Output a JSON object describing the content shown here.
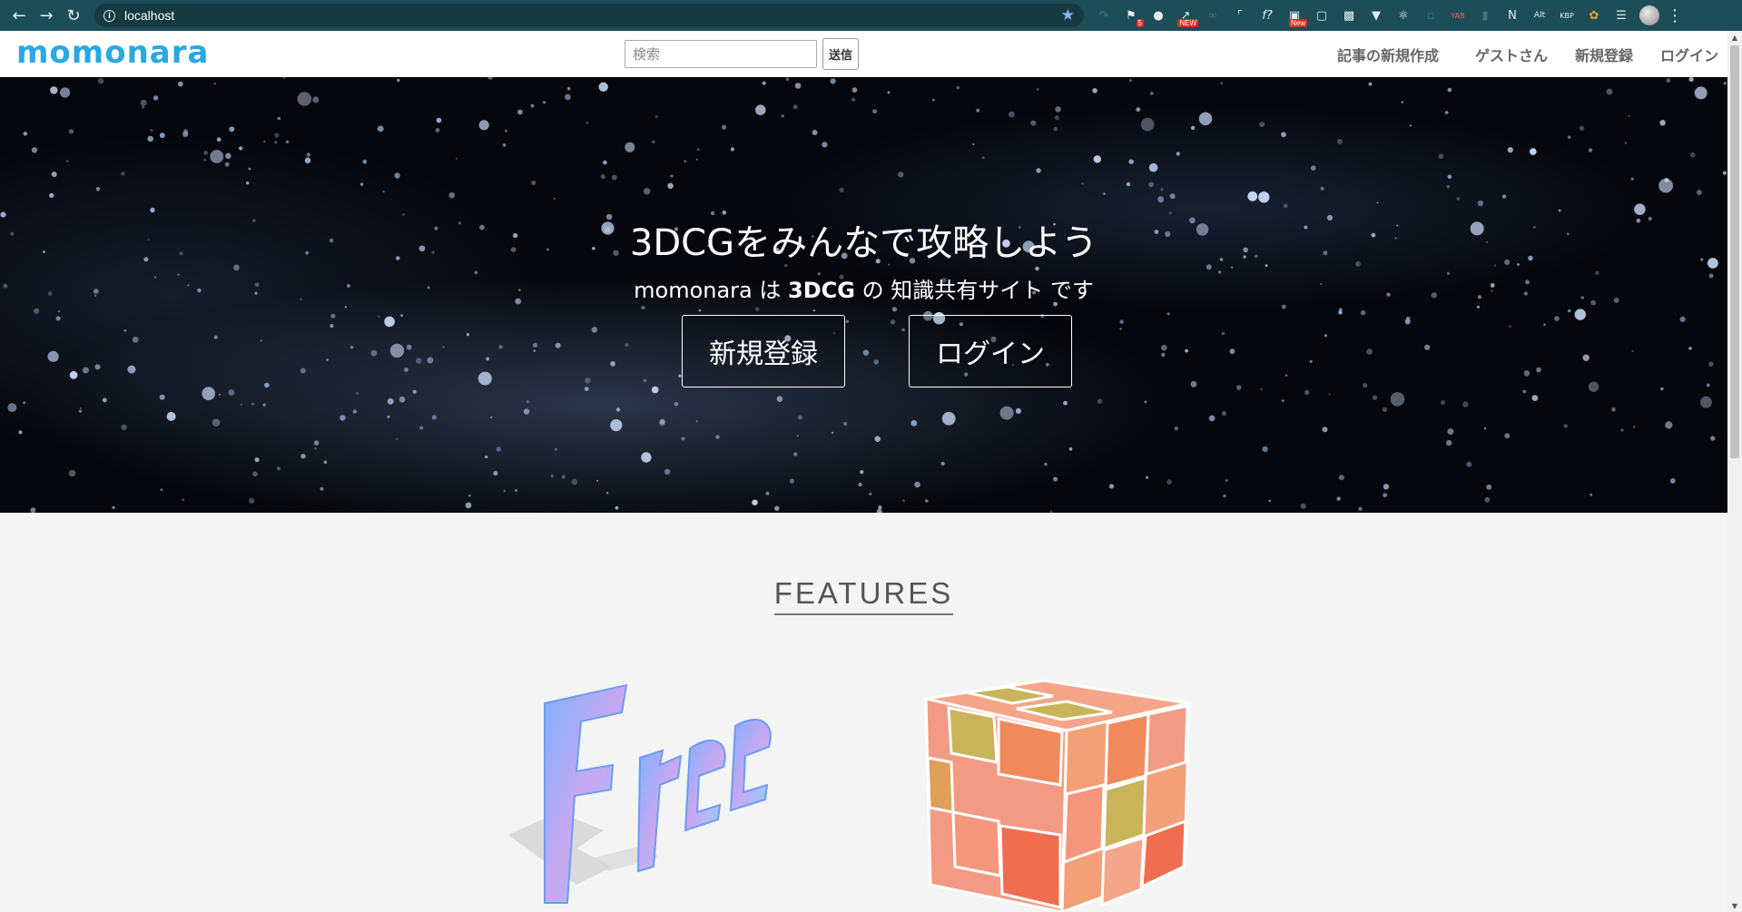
{
  "browser": {
    "url": "localhost",
    "extensions": [
      "flag-icon",
      "devil-icon",
      "new-icon",
      "infinity-icon",
      "bracket-icon",
      "f-icon",
      "new2-icon",
      "square-icon",
      "translate-icon",
      "v-icon",
      "react-icon",
      "css-icon",
      "yab-icon",
      "bookmark-icon",
      "notion-icon",
      "alt-icon",
      "kbp-icon",
      "leaf-icon",
      "list-icon"
    ],
    "ext_badges": {
      "flag": "5",
      "new": "NEW",
      "new2": "New",
      "yab": "YAB",
      "alt": "Alt",
      "kbp": "KBP"
    }
  },
  "site": {
    "logo": "momonara",
    "search_placeholder": "検索",
    "search_button": "送信",
    "nav": {
      "create_article": "記事の新規作成",
      "guest": "ゲストさん",
      "signup": "新規登録",
      "login": "ログイン"
    }
  },
  "hero": {
    "title": "3DCGをみんなで攻略しよう",
    "subtitle_pre": "momonara は ",
    "subtitle_bold": "3DCG",
    "subtitle_post": " の 知識共有サイト です",
    "signup_button": "新規登録",
    "login_button": "ログイン"
  },
  "features": {
    "title": "FEATURES",
    "free_label": "Free"
  },
  "colors": {
    "chrome_bg": "#1d4d56",
    "logo": "#2aa8e0",
    "hero_bg": "#05070c",
    "page_bg": "#f4f4f4",
    "cube_orange": "#f08a5d",
    "cube_olive": "#c9b45a"
  }
}
